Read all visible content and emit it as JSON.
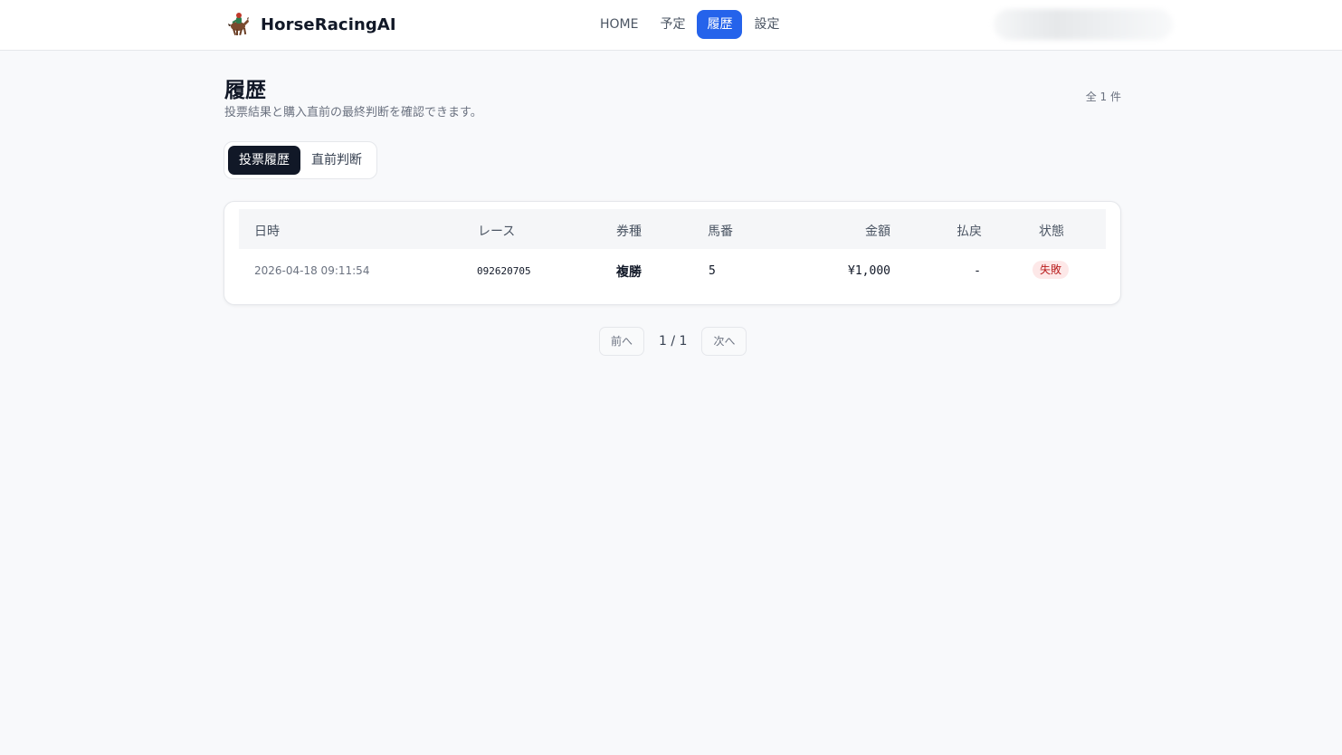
{
  "header": {
    "brand": "HorseRacingAI",
    "nav": [
      {
        "label": "HOME",
        "active": false
      },
      {
        "label": "予定",
        "active": false
      },
      {
        "label": "履歴",
        "active": true
      },
      {
        "label": "設定",
        "active": false
      }
    ]
  },
  "page": {
    "title": "履歴",
    "subtitle": "投票結果と購入直前の最終判断を確認できます。",
    "total": "全 1 件"
  },
  "tabs": [
    {
      "label": "投票履歴",
      "active": true
    },
    {
      "label": "直前判断",
      "active": false
    }
  ],
  "table": {
    "headers": {
      "date": "日時",
      "race": "レース",
      "type": "券種",
      "horse": "馬番",
      "amount": "金額",
      "payout": "払戻",
      "status": "状態"
    },
    "rows": [
      {
        "date": "2026-04-18 09:11:54",
        "race": "092620705",
        "type": "複勝",
        "horse": "5",
        "amount": "¥1,000",
        "payout": "-",
        "status": "失敗"
      }
    ]
  },
  "pagination": {
    "prev": "前へ",
    "info": "1 / 1",
    "next": "次へ"
  },
  "colors": {
    "accent": "#2563eb",
    "dark": "#111827",
    "failed_bg": "#fde8e8",
    "failed_text": "#b91c1c"
  },
  "icons": {
    "brand": "racehorse-jockey-icon"
  }
}
